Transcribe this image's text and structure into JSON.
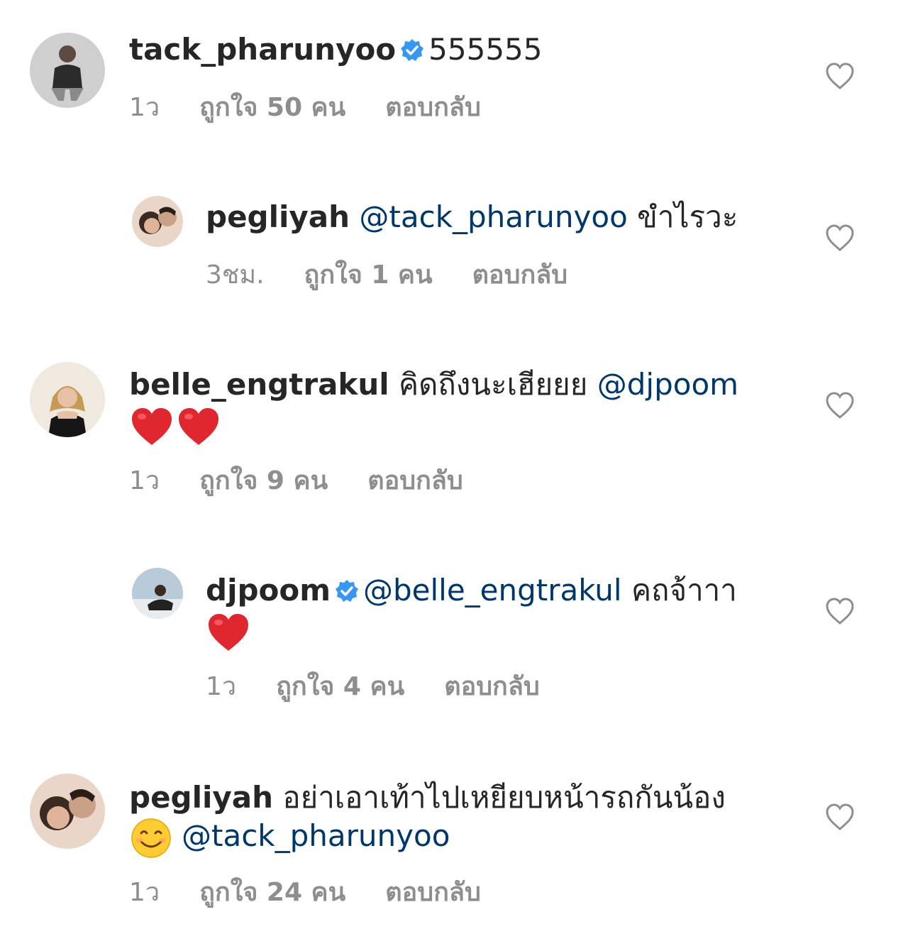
{
  "comments": [
    {
      "username": "tack_pharunyoo",
      "verified": true,
      "text": "555555",
      "time": "1ว",
      "likes": "ถูกใจ 50 คน",
      "reply": "ตอบกลับ"
    },
    {
      "username": "pegliyah",
      "mention": "@tack_pharunyoo",
      "text": "ขำไรวะ",
      "time": "3ชม.",
      "likes": "ถูกใจ 1 คน",
      "reply": "ตอบกลับ"
    },
    {
      "username": "belle_engtrakul",
      "text": "คิดถึงนะเฮียยย",
      "mention": "@djpoom",
      "emoji": "❤️❤️",
      "time": "1ว",
      "likes": "ถูกใจ 9 คน",
      "reply": "ตอบกลับ"
    },
    {
      "username": "djpoom",
      "verified": true,
      "mention": "@belle_engtrakul",
      "text": "คถจ้าาา",
      "emoji": "❤️",
      "time": "1ว",
      "likes": "ถูกใจ 4 คน",
      "reply": "ตอบกลับ"
    },
    {
      "username": "pegliyah",
      "text": "อย่าเอาเท้าไปเหยียบหน้ารถกันน้อง",
      "emoji": "😊",
      "mention": "@tack_pharunyoo",
      "time": "1ว",
      "likes": "ถูกใจ 24 คน",
      "reply": "ตอบกลับ"
    }
  ],
  "colors": {
    "text": "#262626",
    "mention": "#00376b",
    "meta": "#8e8e8e",
    "verified": "#3897f0"
  }
}
